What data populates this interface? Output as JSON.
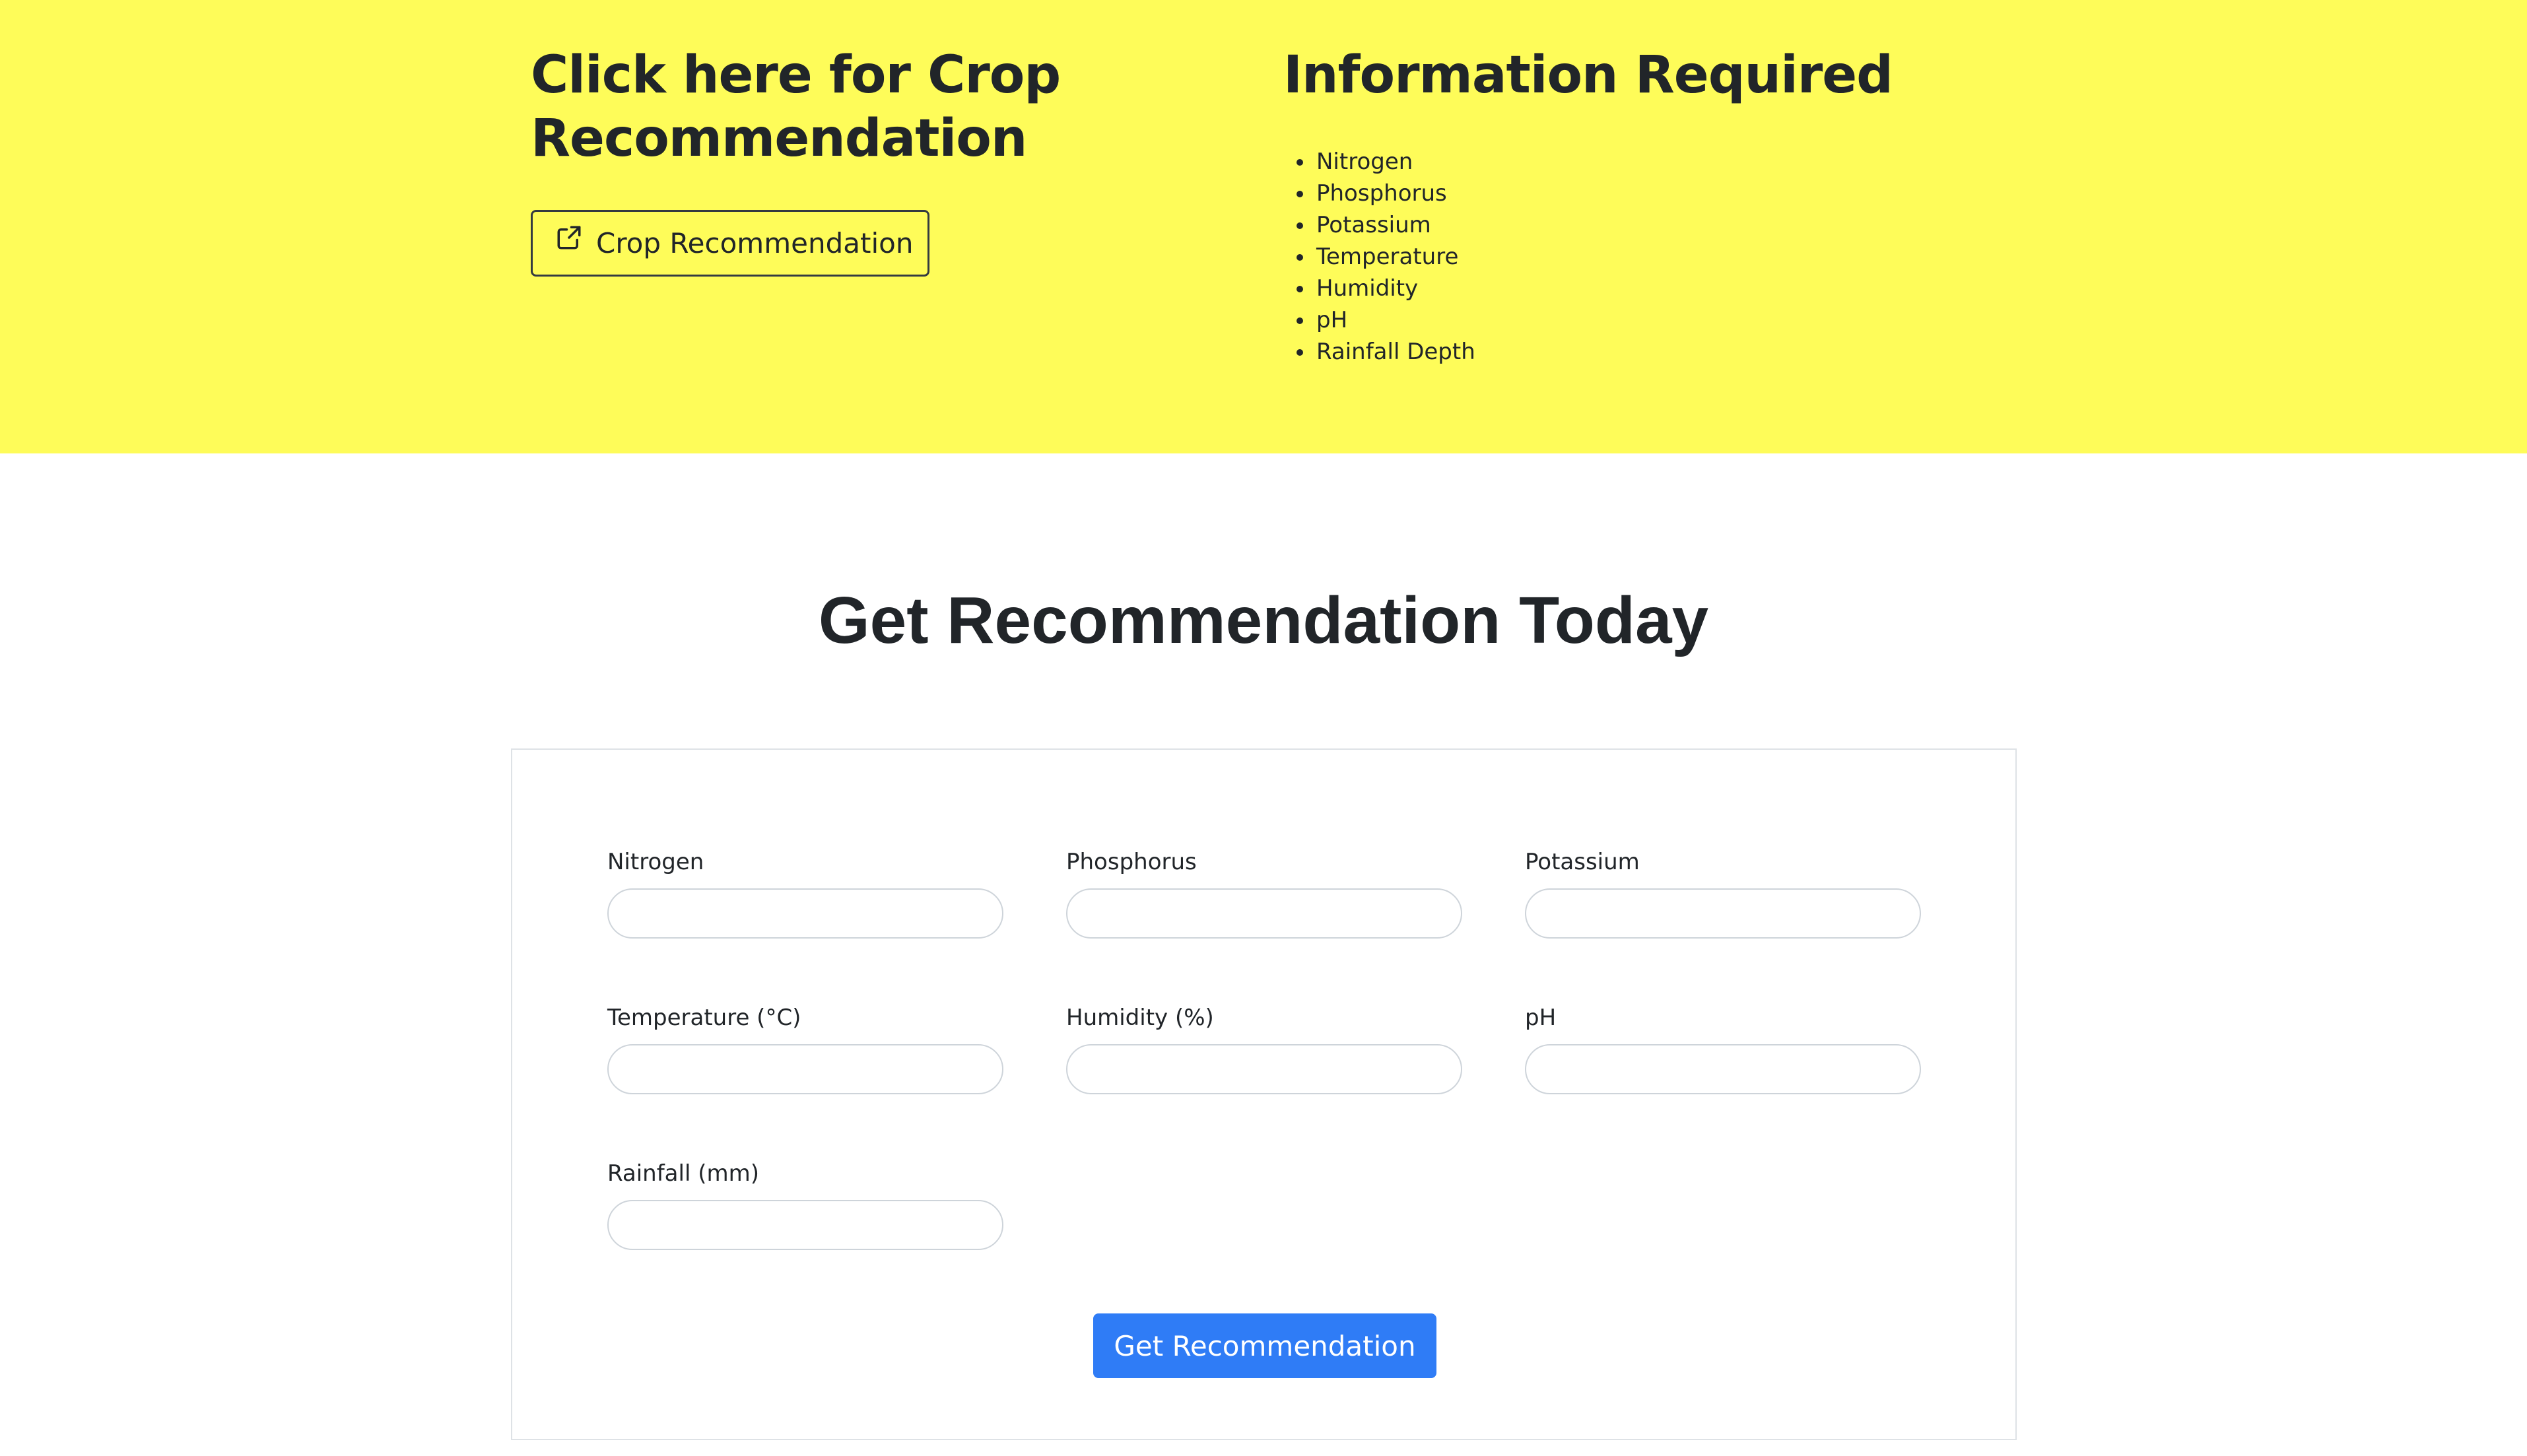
{
  "hero": {
    "left_title": "Click here for Crop Recommendation",
    "crop_button_label": "Crop Recommendation",
    "crop_button_icon": "external-link-icon",
    "info_title": "Information Required",
    "info_items": [
      "Nitrogen",
      "Phosphorus",
      "Potassium",
      "Temperature",
      "Humidity",
      "pH",
      "Rainfall Depth"
    ],
    "background_color": "#fefc59"
  },
  "section": {
    "title": "Get Recommendation Today"
  },
  "form": {
    "fields": [
      {
        "label": "Nitrogen",
        "value": "",
        "placeholder": ""
      },
      {
        "label": "Phosphorus",
        "value": "",
        "placeholder": ""
      },
      {
        "label": "Potassium",
        "value": "",
        "placeholder": ""
      },
      {
        "label": "Temperature (°C)",
        "value": "",
        "placeholder": ""
      },
      {
        "label": "Humidity (%)",
        "value": "",
        "placeholder": ""
      },
      {
        "label": "pH",
        "value": "",
        "placeholder": ""
      },
      {
        "label": "Rainfall (mm)",
        "value": "",
        "placeholder": ""
      }
    ],
    "submit_label": "Get Recommendation",
    "submit_color": "#2f7cf6"
  }
}
